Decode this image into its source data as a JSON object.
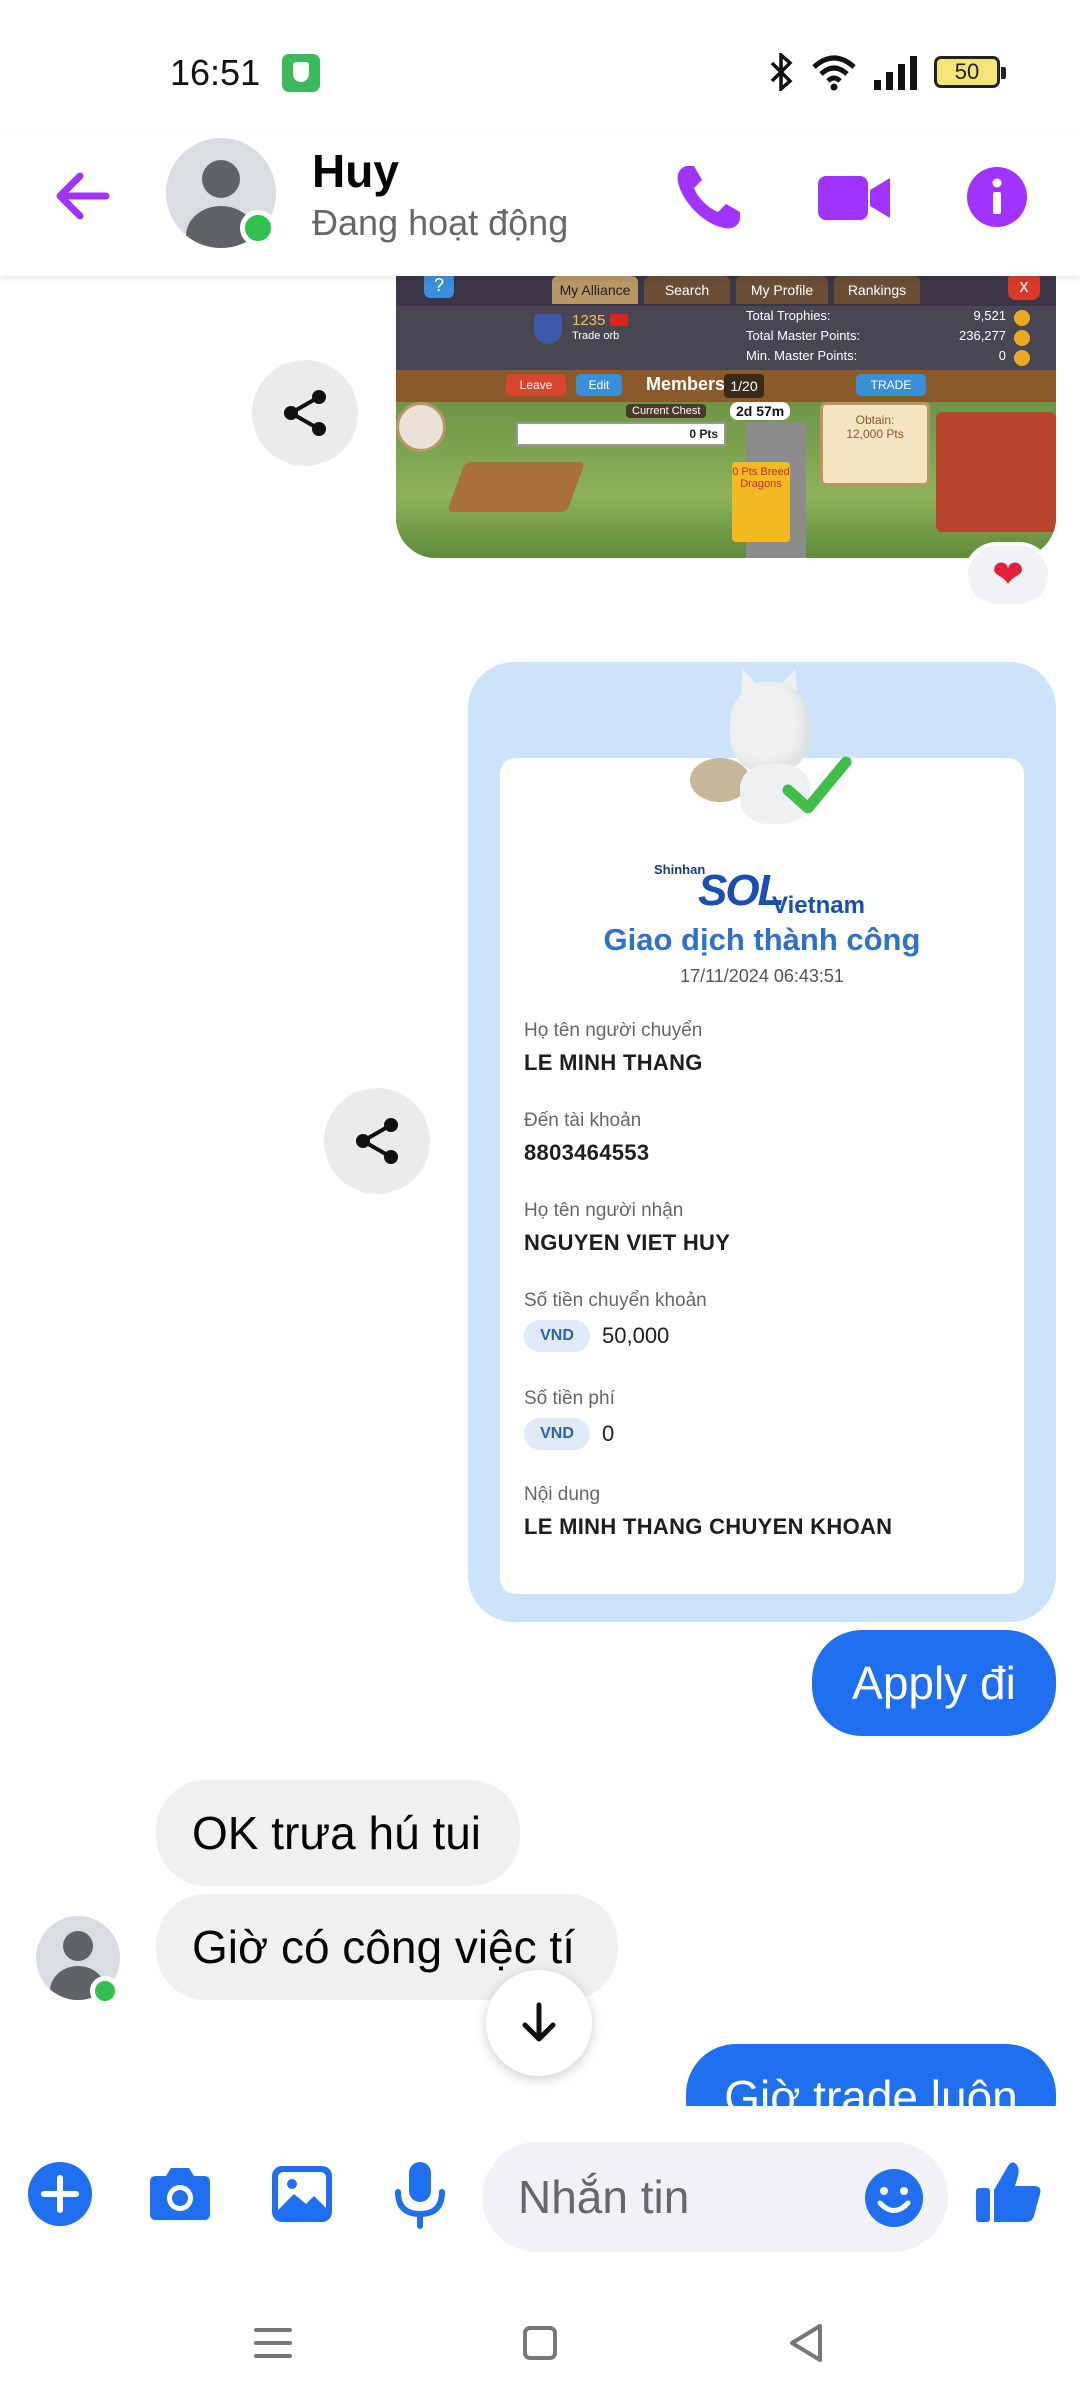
{
  "status_bar": {
    "time": "16:51",
    "battery": "50"
  },
  "header": {
    "name": "Huy",
    "status": "Đang hoạt động"
  },
  "game_screenshot": {
    "tabs": [
      "My Alliance",
      "Search",
      "My Profile",
      "Rankings"
    ],
    "help": "?",
    "close": "x",
    "level": "1235",
    "subtitle": "Trade orb",
    "stats": [
      {
        "label": "Total Trophies:",
        "value": "9,521"
      },
      {
        "label": "Total Master Points:",
        "value": "236,277"
      },
      {
        "label": "Min. Master Points:",
        "value": "0"
      }
    ],
    "leave": "Leave",
    "edit": "Edit",
    "members": "Members",
    "member_count": "1/20",
    "trade": "TRADE",
    "chest": "Current Chest",
    "timer": "2d 57m",
    "points": "0 Pts",
    "breed": "0 Pts Breed Dragons",
    "obtain": "Obtain:",
    "obtain_pts": "12,000 Pts"
  },
  "reaction": "❤",
  "receipt": {
    "bank_prefix": "Shinhan",
    "bank_word": "SOL",
    "bank_country": "Vietnam",
    "title": "Giao dịch thành công",
    "datetime": "17/11/2024 06:43:51",
    "sender_label": "Họ tên người chuyển",
    "sender": "LE MINH THANG",
    "account_label": "Đến tài khoản",
    "account": "8803464553",
    "receiver_label": "Họ tên người nhận",
    "receiver": "NGUYEN VIET HUY",
    "amount_label": "Số tiền chuyển khoản",
    "currency": "VND",
    "amount": "50,000",
    "fee_label": "Số tiền phí",
    "fee": "0",
    "content_label": "Nội dung",
    "content": "LE MINH THANG CHUYEN KHOAN"
  },
  "messages": [
    {
      "side": "sent",
      "text": "Apply đi"
    },
    {
      "side": "received",
      "text": "OK trưa hú tui"
    },
    {
      "side": "received",
      "text": "Giờ có công việc tí"
    },
    {
      "side": "sent",
      "text": "Giờ trade luôn"
    }
  ],
  "composer": {
    "placeholder": "Nhắn tin"
  },
  "colors": {
    "accent": "#1f6ff0",
    "header_icons": "#a033ff",
    "online": "#31c24d",
    "receipt_bg": "#cce3fa"
  }
}
